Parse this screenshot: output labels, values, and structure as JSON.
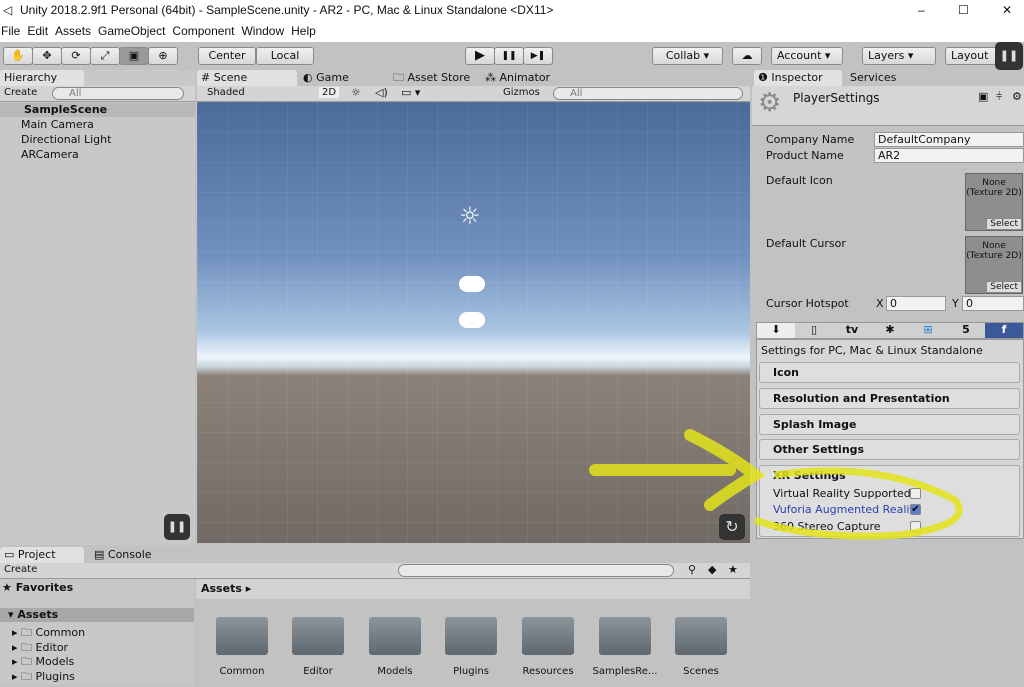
{
  "window": {
    "title": "Unity 2018.2.9f1 Personal (64bit) - SampleScene.unity - AR2 - PC, Mac & Linux Standalone <DX11>",
    "controls": [
      "–",
      "☐",
      "✕"
    ]
  },
  "menu": [
    "File",
    "Edit",
    "Assets",
    "GameObject",
    "Component",
    "Window",
    "Help"
  ],
  "toolbar": {
    "tools": [
      "✋",
      "✥",
      "⟳",
      "⤢",
      "▣",
      "⊕"
    ],
    "pivot": "Center",
    "space": "Local",
    "play": "▶",
    "pause": "❚❚",
    "step": "▶❚",
    "collab": "Collab ▾",
    "account": "Account",
    "layers": "Layers",
    "layout": "Layout"
  },
  "hierarchy": {
    "tab": "Hierarchy",
    "create": "Create",
    "search": "All",
    "scene": "SampleScene",
    "items": [
      "Main Camera",
      "Directional Light",
      "ARCamera"
    ]
  },
  "scene": {
    "tabs": [
      "Scene",
      "Game",
      "Asset Store",
      "Animator"
    ],
    "shading": "Shaded",
    "mode2d": "2D",
    "gizmos": "Gizmos",
    "search": "All"
  },
  "inspector": {
    "tabs": [
      "Inspector",
      "Services"
    ],
    "title": "PlayerSettings",
    "company_label": "Company Name",
    "company": "DefaultCompany",
    "product_label": "Product Name",
    "product": "AR2",
    "default_icon": "Default Icon",
    "default_cursor": "Default Cursor",
    "none_texture": "None (Texture 2D)",
    "select": "Select",
    "hotspot_label": "Cursor Hotspot",
    "x_label": "X",
    "x": "0",
    "y_label": "Y",
    "y": "0",
    "platform_tabs": [
      "⬇",
      "▯",
      "tv",
      "✱",
      "⊞",
      "5",
      "f"
    ],
    "platform_title": "Settings for PC, Mac & Linux Standalone",
    "sections": [
      "Icon",
      "Resolution and Presentation",
      "Splash Image",
      "Other Settings"
    ],
    "xr": {
      "title": "XR Settings",
      "options": [
        {
          "label": "Virtual Reality Supported",
          "checked": false
        },
        {
          "label": "Vuforia Augmented Realit",
          "checked": true
        },
        {
          "label": "360 Stereo Capture",
          "checked": false
        }
      ]
    }
  },
  "project": {
    "tabs": [
      "Project",
      "Console"
    ],
    "create": "Create",
    "favorites": "Favorites",
    "assets_root": "Assets",
    "breadcrumb": "Assets ▸",
    "tree": [
      "Common",
      "Editor",
      "Models",
      "Plugins"
    ],
    "folders": [
      "Common",
      "Editor",
      "Models",
      "Plugins",
      "Resources",
      "SamplesRe...",
      "Scenes"
    ]
  },
  "colors": {
    "highlight": "#e3e31a",
    "link": "#2b3fa8"
  }
}
